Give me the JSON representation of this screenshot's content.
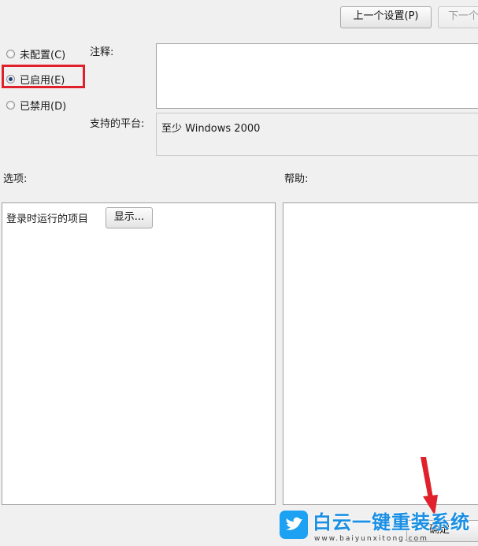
{
  "top_buttons": {
    "prev": "上一个设置(P)",
    "next": "下一个"
  },
  "state_options": [
    {
      "label": "未配置(C)",
      "checked": false
    },
    {
      "label": "已启用(E)",
      "checked": true
    },
    {
      "label": "已禁用(D)",
      "checked": false
    }
  ],
  "comment": {
    "label": "注释:",
    "value": ""
  },
  "platform": {
    "label": "支持的平台:",
    "value": "至少 Windows 2000"
  },
  "options": {
    "label": "选项:",
    "item_label": "登录时运行的项目",
    "show_button": "显示..."
  },
  "help": {
    "label": "帮助:",
    "text": ""
  },
  "footer": {
    "ok_button": "确定"
  },
  "watermark": {
    "brand": "白云一键重装系统",
    "url": "www.baiyunxitong.com"
  },
  "colors": {
    "highlight": "#e0202a",
    "arrow": "#e0202a",
    "logo_blue": "#1da1f2"
  }
}
